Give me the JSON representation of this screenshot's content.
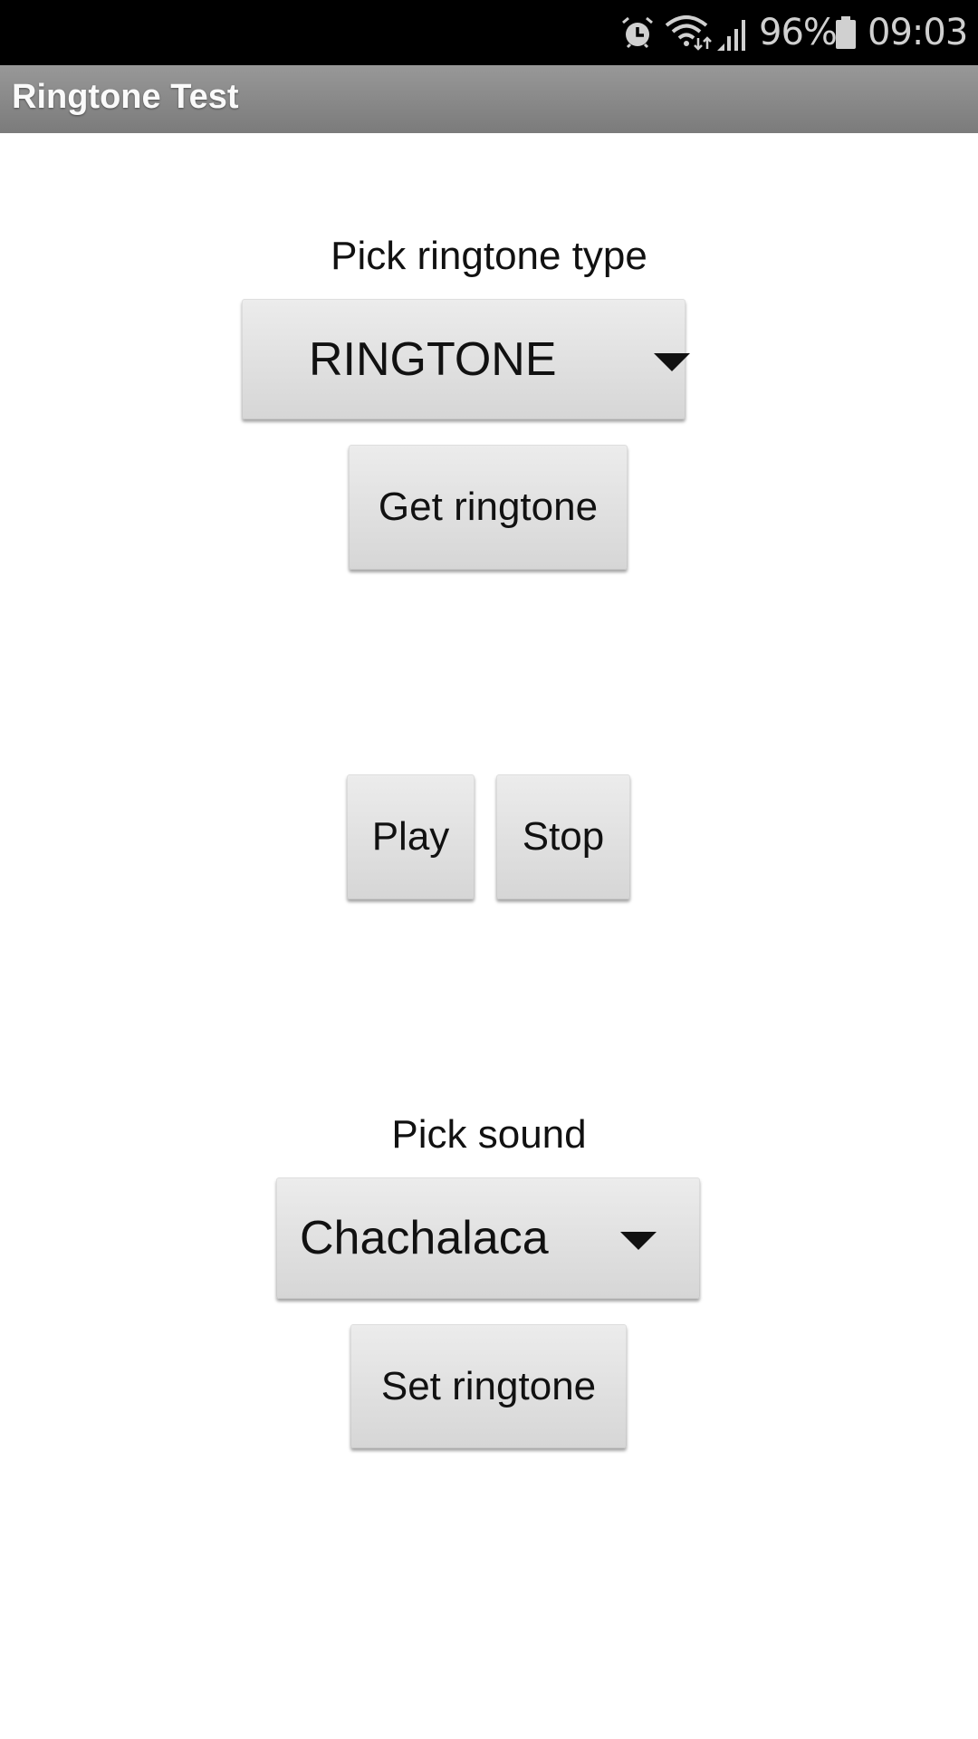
{
  "status_bar": {
    "icons": [
      "alarm-icon",
      "wifi-icon",
      "signal-icon",
      "battery-icon"
    ],
    "battery_percent": "96%",
    "time": "09:03"
  },
  "app": {
    "title": "Ringtone Test"
  },
  "ringtone_type": {
    "label": "Pick ringtone type",
    "selected": "RINGTONE",
    "get_button": "Get ringtone"
  },
  "playback": {
    "play_button": "Play",
    "stop_button": "Stop"
  },
  "sound": {
    "label": "Pick sound",
    "selected": "Chachalaca",
    "set_button": "Set ringtone"
  }
}
